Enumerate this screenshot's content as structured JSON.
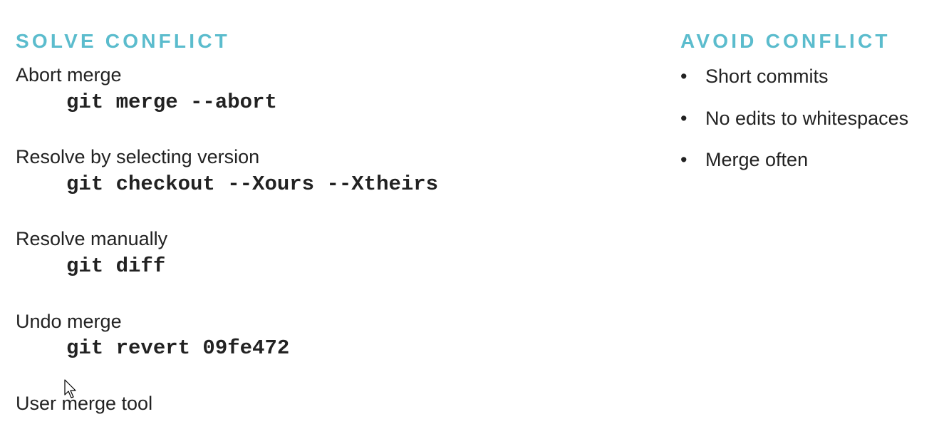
{
  "solve": {
    "heading": "SOLVE CONFLICT",
    "items": [
      {
        "label": "Abort merge",
        "code": "git merge --abort"
      },
      {
        "label": "Resolve by selecting version",
        "code": "git checkout --Xours --Xtheirs"
      },
      {
        "label": "Resolve manually",
        "code": "git diff"
      },
      {
        "label": "Undo merge",
        "code": "git revert 09fe472"
      },
      {
        "label": "User merge tool",
        "code": ""
      }
    ]
  },
  "avoid": {
    "heading": "AVOID CONFLICT",
    "bullets": [
      "Short commits",
      "No edits to whitespaces",
      "Merge often"
    ]
  },
  "colors": {
    "heading": "#5bbccd",
    "text": "#222222"
  },
  "icons": {
    "bullet": "•",
    "cursor": "mouse-pointer-icon"
  }
}
